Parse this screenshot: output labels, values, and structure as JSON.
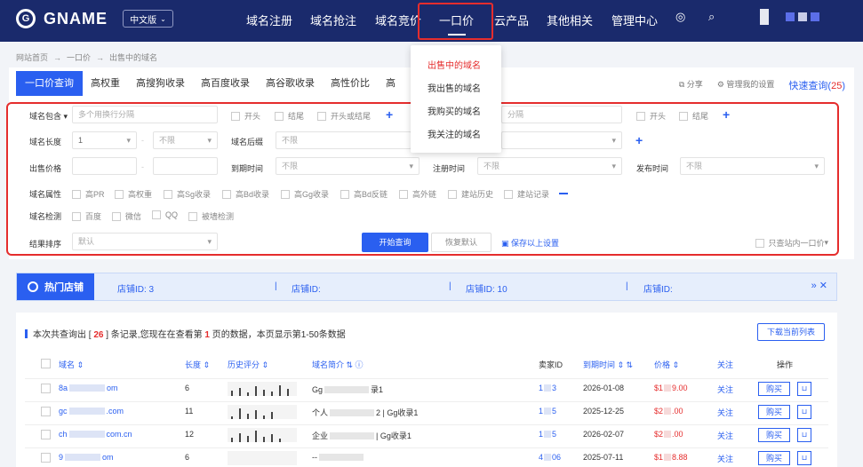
{
  "header": {
    "logo_letter": "G",
    "logo_text": "GNAME",
    "lang": "中文版",
    "nav": [
      "域名注册",
      "域名抢注",
      "域名竞价",
      "一口价",
      "云产品",
      "其他相关",
      "管理中心"
    ],
    "icons": [
      "headset-icon",
      "search-icon",
      "user-icon"
    ]
  },
  "breadcrumb": [
    "网站首页",
    "一口价",
    "出售中的域名"
  ],
  "dropdown": [
    "出售中的域名",
    "我出售的域名",
    "我购买的域名",
    "我关注的域名"
  ],
  "tabs": [
    "一口价查询",
    "高权重",
    "高搜狗收录",
    "高百度收录",
    "高谷歌收录",
    "高性价比",
    "高"
  ],
  "tab_actions": {
    "share": "分享",
    "manage": "管理我的设置",
    "quick_label": "快速查询(",
    "quick_count": "25",
    "quick_end": ")"
  },
  "filters": {
    "domain_contains": {
      "label": "域名包含",
      "placeholder": "多个用换行分隔",
      "opts": [
        "开头",
        "结尾",
        "开头或结尾"
      ]
    },
    "domain_exclude": {
      "placeholder": "分隔",
      "opts": [
        "开头",
        "结尾"
      ]
    },
    "length": {
      "label": "域名长度",
      "min": "1",
      "max": "不限"
    },
    "suffix": {
      "label": "域名后缀",
      "value": "不限"
    },
    "price": {
      "label": "出售价格"
    },
    "expire": {
      "label": "到期时间",
      "value": "不限"
    },
    "register": {
      "label": "注册时间",
      "value": "不限"
    },
    "publish": {
      "label": "发布时间",
      "value": "不限"
    },
    "attrs": {
      "label": "域名属性",
      "opts": [
        "高PR",
        "高权重",
        "高Sg收录",
        "高Bd收录",
        "高Gg收录",
        "高Bd反链",
        "高外链",
        "建站历史",
        "建站记录"
      ]
    },
    "check": {
      "label": "域名检测",
      "opts": [
        "百度",
        "微信",
        "QQ",
        "被墙检测"
      ]
    },
    "sort": {
      "label": "结果排序",
      "value": "默认"
    },
    "search_btn": "开始查询",
    "reset_btn": "恢复默认",
    "save_settings": "保存以上设置",
    "only_site": "只查站内一口价"
  },
  "shop": {
    "badge": "热门店铺",
    "items": [
      "店铺ID: 3",
      "店铺ID:",
      "店铺ID: 10",
      "店铺ID:"
    ],
    "more": "»  ✕"
  },
  "results": {
    "summary_prefix": "本次共查询出 [ ",
    "summary_count": "26",
    "summary_mid": " ] 条记录,您现在在查看第 ",
    "summary_page": "1",
    "summary_suffix": " 页的数据，本页显示第1-50条数据",
    "download": "下载当前列表",
    "columns": [
      "域名 ⇕",
      "长度 ⇕",
      "历史评分 ⇕",
      "域名简介 ⇅ ⓘ",
      "卖家ID",
      "到期时间 ⇕ ⇅",
      "价格 ⇕",
      "关注",
      "操作"
    ],
    "rows": [
      {
        "domain": "8a",
        "domain_end": "om",
        "length": "6",
        "intro": "Gg",
        "intro_end": "录1",
        "seller": "1",
        "seller_end": "3",
        "expire": "2026-01-08",
        "price": "$1",
        "price_end": "9.00"
      },
      {
        "domain": "gc",
        "domain_end": ".com",
        "length": "11",
        "intro": "个人",
        "intro_end": "2 | Gg收录1",
        "seller": "1",
        "seller_end": "5",
        "expire": "2025-12-25",
        "price": "$2",
        "price_end": ".00"
      },
      {
        "domain": "ch",
        "domain_end": "com.cn",
        "length": "12",
        "intro": "企业",
        "intro_end": "| Gg收录1",
        "seller": "1",
        "seller_end": "5",
        "expire": "2026-02-07",
        "price": "$2",
        "price_end": ".00"
      },
      {
        "domain": "9",
        "domain_end": "om",
        "length": "6",
        "intro": "--",
        "intro_end": "",
        "seller": "4",
        "seller_end": "06",
        "expire": "2025-07-11",
        "price": "$1",
        "price_end": "8.88"
      }
    ],
    "follow": "关注",
    "buy": "购买",
    "cart_icon": "cart-icon"
  }
}
